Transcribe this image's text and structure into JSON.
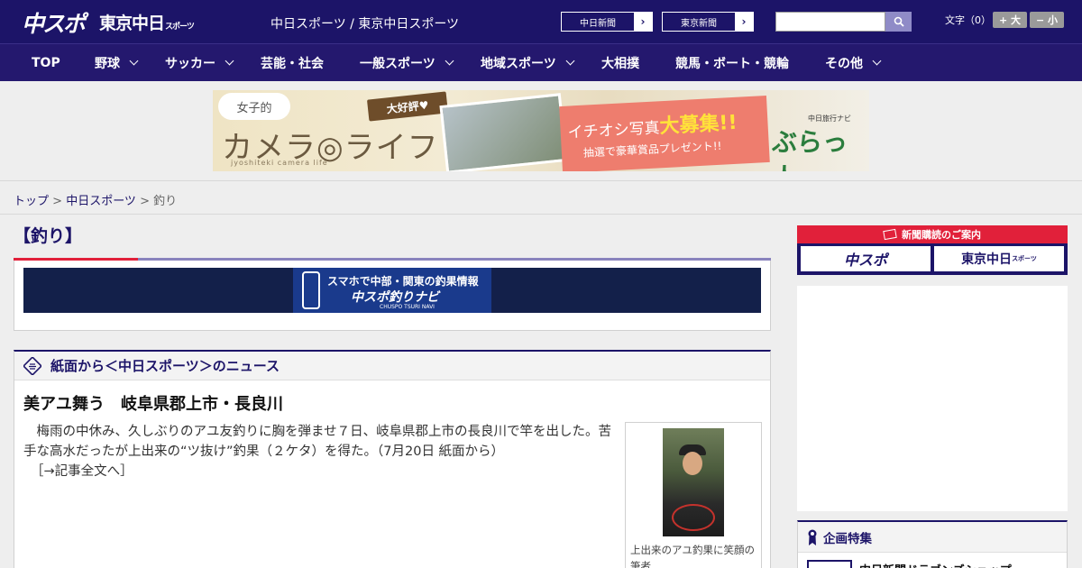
{
  "header": {
    "logo_main": "中スポ",
    "logo_tokyo": "東京中日",
    "logo_tokyo_suffix": "スポーツ",
    "site_names": "中日スポーツ / 東京中日スポーツ",
    "newspaper_links": [
      {
        "label": "中日新聞"
      },
      {
        "label": "東京新聞"
      }
    ],
    "search": {
      "value": "",
      "placeholder": ""
    },
    "text_size_label": "文字（0）",
    "size_up": "+ 大",
    "size_down": "− 小",
    "brand_color": "#1c1468"
  },
  "nav": {
    "items": [
      {
        "label": "TOP",
        "dropdown": false
      },
      {
        "label": "野球",
        "dropdown": true
      },
      {
        "label": "サッカー",
        "dropdown": true
      },
      {
        "label": "芸能・社会",
        "dropdown": false
      },
      {
        "label": "一般スポーツ",
        "dropdown": true
      },
      {
        "label": "地域スポーツ",
        "dropdown": true
      },
      {
        "label": "大相撲",
        "dropdown": false
      },
      {
        "label": "競馬・ボート・競輪",
        "dropdown": false
      },
      {
        "label": "その他",
        "dropdown": true
      }
    ]
  },
  "banner": {
    "bubble": "女子的",
    "title": "カメラ◎ライフ",
    "sub": "jyoshiteki camera life",
    "popular": "大好評♥",
    "headline_a": "イチオシ写真",
    "headline_b": "大募集!!",
    "prize": "抽選で豪華賞品プレゼント!!",
    "brand_small": "中日旅行ナビ",
    "brand": "ぶらっ人"
  },
  "breadcrumb": {
    "home": "トップ",
    "section": "中日スポーツ",
    "current": "釣り",
    "sep": " > "
  },
  "main": {
    "heading": "【釣り】",
    "accent_color": "#e1203a",
    "navi_banner": {
      "line1": "スマホで中部・関東の釣果情報",
      "line2": "中スポ釣りナビ",
      "line3": "CHUSPO TSURI NAVI"
    },
    "news": {
      "section_title": "紙面から＜中日スポーツ＞のニュース",
      "article_title": "美アユ舞う　岐阜県郡上市・長良川",
      "article_body": "梅雨の中休み、久しぶりのアユ友釣りに胸を弾ませ７日、岐阜県郡上市の長良川で竿を出した。苦手な高水だったが上出来の“ツ抜け”釣果（２ケタ）を得た。（7月20日 紙面から）",
      "more_link": "［→記事全文へ］",
      "photo_caption": "上出来のアユ釣果に笑顔の筆者"
    }
  },
  "sidebar": {
    "subscribe_title": "新聞購読のご案内",
    "sub_chuspo": "中スポ",
    "sub_tokyo": "東京中日",
    "sub_tokyo_suffix": "スポーツ",
    "special_title": "企画特集",
    "special_item": "中日新聞ドラゴンズショップ"
  }
}
